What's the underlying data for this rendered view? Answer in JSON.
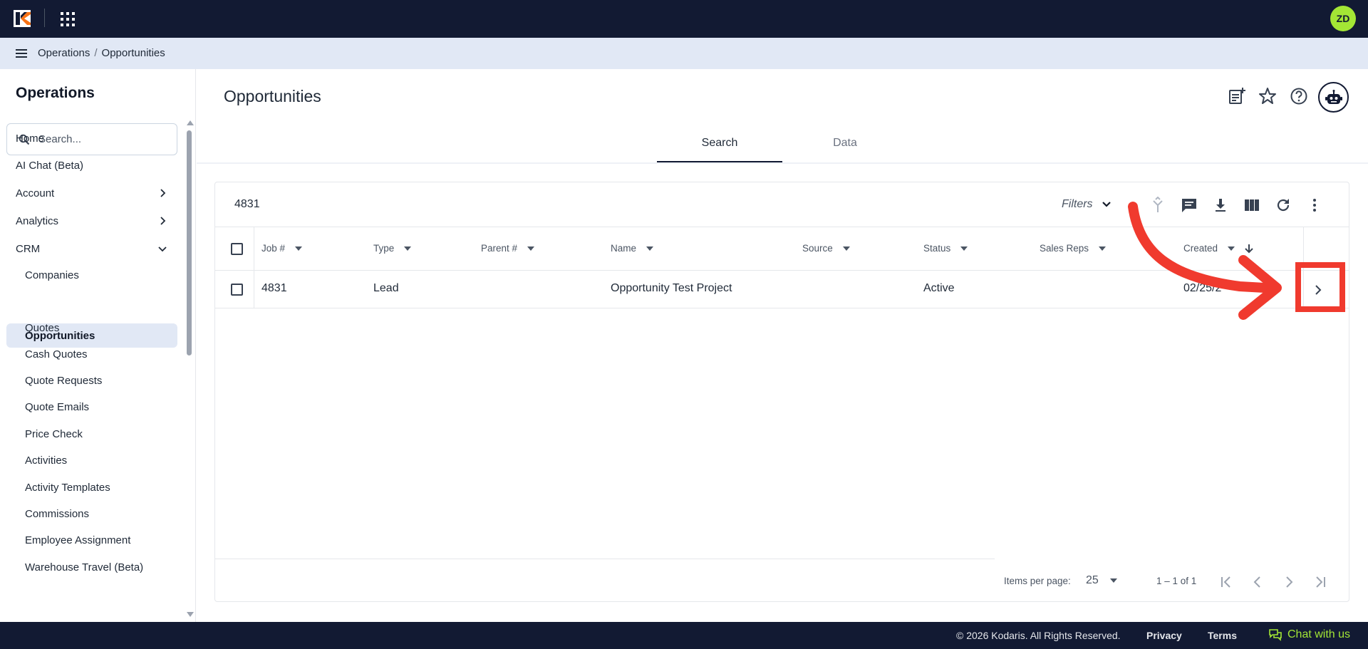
{
  "topbar": {
    "logo_icon": "kodaris-logo",
    "apps_icon": "apps-grid-icon",
    "avatar_initials": "ZD",
    "avatar_color": "#a3e635",
    "background": "#121a33"
  },
  "breadcrumb": {
    "menu_icon": "menu-icon",
    "items": [
      "Operations",
      "Opportunities"
    ],
    "separator": "/"
  },
  "sidebar": {
    "title": "Operations",
    "search_placeholder": "Search...",
    "items": [
      {
        "label": "Home",
        "level": "top",
        "chevron": "none"
      },
      {
        "label": "AI Chat (Beta)",
        "level": "top",
        "chevron": "none"
      },
      {
        "label": "Account",
        "level": "top",
        "chevron": "right"
      },
      {
        "label": "Analytics",
        "level": "top",
        "chevron": "right"
      },
      {
        "label": "CRM",
        "level": "top",
        "chevron": "down"
      },
      {
        "label": "Companies",
        "level": "sub"
      },
      {
        "label": "Opportunities",
        "level": "sub",
        "active": true
      },
      {
        "label": "Quotes",
        "level": "sub"
      },
      {
        "label": "Cash Quotes",
        "level": "sub"
      },
      {
        "label": "Quote Requests",
        "level": "sub"
      },
      {
        "label": "Quote Emails",
        "level": "sub"
      },
      {
        "label": "Price Check",
        "level": "sub"
      },
      {
        "label": "Activities",
        "level": "sub"
      },
      {
        "label": "Activity Templates",
        "level": "sub"
      },
      {
        "label": "Commissions",
        "level": "sub"
      },
      {
        "label": "Employee Assignment",
        "level": "sub"
      },
      {
        "label": "Warehouse Travel (Beta)",
        "level": "sub"
      }
    ]
  },
  "main": {
    "title": "Opportunities",
    "header_icons": [
      "add-note-icon",
      "star-icon",
      "help-icon",
      "robot-icon"
    ],
    "tabs": [
      {
        "label": "Search",
        "active": true
      },
      {
        "label": "Data",
        "active": false
      }
    ]
  },
  "table": {
    "count": "4831",
    "filters_label": "Filters",
    "toolbar_icons": [
      "merge-icon",
      "comment-icon",
      "download-icon",
      "columns-icon",
      "refresh-icon",
      "more-vert-icon"
    ],
    "columns": [
      "Job #",
      "Type",
      "Parent #",
      "Name",
      "Source",
      "Status",
      "Sales Reps",
      "Created"
    ],
    "rows": [
      {
        "job": "4831",
        "type": "Lead",
        "parent": "",
        "name": "Opportunity Test Project",
        "source": "",
        "status": "Active",
        "sales_reps": "",
        "created": "02/25/2"
      }
    ],
    "sort": {
      "column": "Created",
      "direction": "descending"
    },
    "pagination": {
      "items_per_page_label": "Items per page:",
      "items_per_page": "25",
      "range": "1 – 1 of 1"
    }
  },
  "annotation": {
    "color": "#f03a2e",
    "target": "row-open-arrow"
  },
  "footer": {
    "copyright": "© 2026 Kodaris. All Rights Reserved.",
    "privacy": "Privacy",
    "terms": "Terms",
    "chat": "Chat with us",
    "chat_color": "#a3e635"
  }
}
